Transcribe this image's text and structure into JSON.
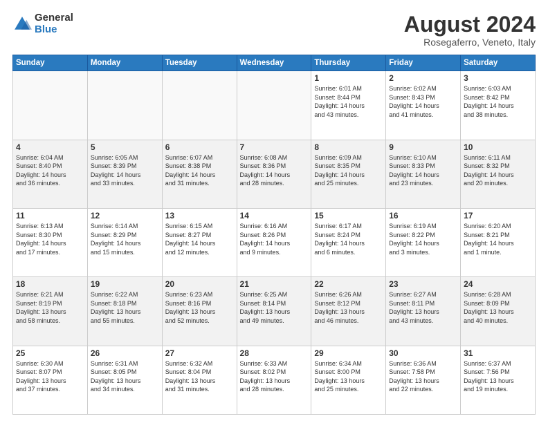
{
  "logo": {
    "general": "General",
    "blue": "Blue"
  },
  "header": {
    "month_year": "August 2024",
    "location": "Rosegaferro, Veneto, Italy"
  },
  "weekdays": [
    "Sunday",
    "Monday",
    "Tuesday",
    "Wednesday",
    "Thursday",
    "Friday",
    "Saturday"
  ],
  "weeks": [
    [
      {
        "day": "",
        "info": ""
      },
      {
        "day": "",
        "info": ""
      },
      {
        "day": "",
        "info": ""
      },
      {
        "day": "",
        "info": ""
      },
      {
        "day": "1",
        "info": "Sunrise: 6:01 AM\nSunset: 8:44 PM\nDaylight: 14 hours\nand 43 minutes."
      },
      {
        "day": "2",
        "info": "Sunrise: 6:02 AM\nSunset: 8:43 PM\nDaylight: 14 hours\nand 41 minutes."
      },
      {
        "day": "3",
        "info": "Sunrise: 6:03 AM\nSunset: 8:42 PM\nDaylight: 14 hours\nand 38 minutes."
      }
    ],
    [
      {
        "day": "4",
        "info": "Sunrise: 6:04 AM\nSunset: 8:40 PM\nDaylight: 14 hours\nand 36 minutes."
      },
      {
        "day": "5",
        "info": "Sunrise: 6:05 AM\nSunset: 8:39 PM\nDaylight: 14 hours\nand 33 minutes."
      },
      {
        "day": "6",
        "info": "Sunrise: 6:07 AM\nSunset: 8:38 PM\nDaylight: 14 hours\nand 31 minutes."
      },
      {
        "day": "7",
        "info": "Sunrise: 6:08 AM\nSunset: 8:36 PM\nDaylight: 14 hours\nand 28 minutes."
      },
      {
        "day": "8",
        "info": "Sunrise: 6:09 AM\nSunset: 8:35 PM\nDaylight: 14 hours\nand 25 minutes."
      },
      {
        "day": "9",
        "info": "Sunrise: 6:10 AM\nSunset: 8:33 PM\nDaylight: 14 hours\nand 23 minutes."
      },
      {
        "day": "10",
        "info": "Sunrise: 6:11 AM\nSunset: 8:32 PM\nDaylight: 14 hours\nand 20 minutes."
      }
    ],
    [
      {
        "day": "11",
        "info": "Sunrise: 6:13 AM\nSunset: 8:30 PM\nDaylight: 14 hours\nand 17 minutes."
      },
      {
        "day": "12",
        "info": "Sunrise: 6:14 AM\nSunset: 8:29 PM\nDaylight: 14 hours\nand 15 minutes."
      },
      {
        "day": "13",
        "info": "Sunrise: 6:15 AM\nSunset: 8:27 PM\nDaylight: 14 hours\nand 12 minutes."
      },
      {
        "day": "14",
        "info": "Sunrise: 6:16 AM\nSunset: 8:26 PM\nDaylight: 14 hours\nand 9 minutes."
      },
      {
        "day": "15",
        "info": "Sunrise: 6:17 AM\nSunset: 8:24 PM\nDaylight: 14 hours\nand 6 minutes."
      },
      {
        "day": "16",
        "info": "Sunrise: 6:19 AM\nSunset: 8:22 PM\nDaylight: 14 hours\nand 3 minutes."
      },
      {
        "day": "17",
        "info": "Sunrise: 6:20 AM\nSunset: 8:21 PM\nDaylight: 14 hours\nand 1 minute."
      }
    ],
    [
      {
        "day": "18",
        "info": "Sunrise: 6:21 AM\nSunset: 8:19 PM\nDaylight: 13 hours\nand 58 minutes."
      },
      {
        "day": "19",
        "info": "Sunrise: 6:22 AM\nSunset: 8:18 PM\nDaylight: 13 hours\nand 55 minutes."
      },
      {
        "day": "20",
        "info": "Sunrise: 6:23 AM\nSunset: 8:16 PM\nDaylight: 13 hours\nand 52 minutes."
      },
      {
        "day": "21",
        "info": "Sunrise: 6:25 AM\nSunset: 8:14 PM\nDaylight: 13 hours\nand 49 minutes."
      },
      {
        "day": "22",
        "info": "Sunrise: 6:26 AM\nSunset: 8:12 PM\nDaylight: 13 hours\nand 46 minutes."
      },
      {
        "day": "23",
        "info": "Sunrise: 6:27 AM\nSunset: 8:11 PM\nDaylight: 13 hours\nand 43 minutes."
      },
      {
        "day": "24",
        "info": "Sunrise: 6:28 AM\nSunset: 8:09 PM\nDaylight: 13 hours\nand 40 minutes."
      }
    ],
    [
      {
        "day": "25",
        "info": "Sunrise: 6:30 AM\nSunset: 8:07 PM\nDaylight: 13 hours\nand 37 minutes."
      },
      {
        "day": "26",
        "info": "Sunrise: 6:31 AM\nSunset: 8:05 PM\nDaylight: 13 hours\nand 34 minutes."
      },
      {
        "day": "27",
        "info": "Sunrise: 6:32 AM\nSunset: 8:04 PM\nDaylight: 13 hours\nand 31 minutes."
      },
      {
        "day": "28",
        "info": "Sunrise: 6:33 AM\nSunset: 8:02 PM\nDaylight: 13 hours\nand 28 minutes."
      },
      {
        "day": "29",
        "info": "Sunrise: 6:34 AM\nSunset: 8:00 PM\nDaylight: 13 hours\nand 25 minutes."
      },
      {
        "day": "30",
        "info": "Sunrise: 6:36 AM\nSunset: 7:58 PM\nDaylight: 13 hours\nand 22 minutes."
      },
      {
        "day": "31",
        "info": "Sunrise: 6:37 AM\nSunset: 7:56 PM\nDaylight: 13 hours\nand 19 minutes."
      }
    ]
  ]
}
